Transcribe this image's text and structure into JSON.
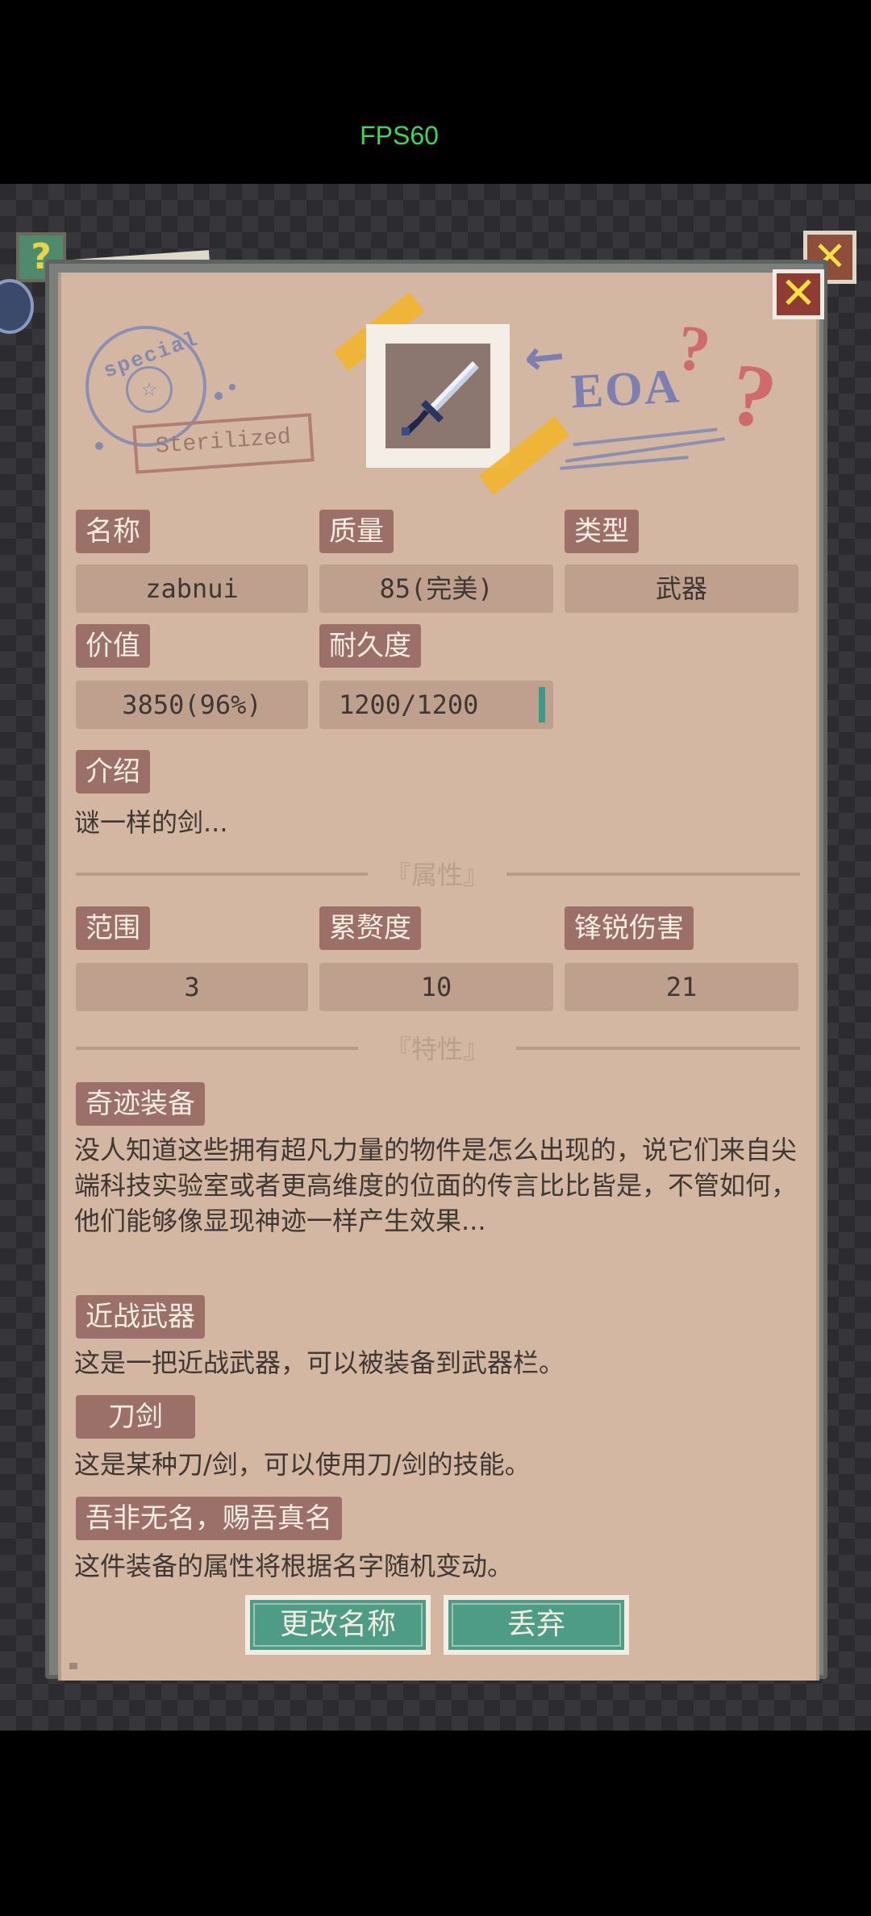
{
  "status": {
    "fps": "FPS60"
  },
  "panel": {
    "stamp": {
      "text": "special",
      "badge": "Sterilized"
    },
    "logo": "EOA",
    "fields": {
      "name_label": "名称",
      "name_value": "zabnui",
      "quality_label": "质量",
      "quality_value": "85(完美)",
      "type_label": "类型",
      "type_value": "武器",
      "value_label": "价值",
      "value_value": "3850(96%)",
      "durability_label": "耐久度",
      "durability_value": "1200/1200"
    },
    "durability_fraction": 1.0,
    "intro_label": "介绍",
    "intro_text": "谜一样的剑...",
    "attributes_title": "『属性』",
    "attributes": {
      "range_label": "范围",
      "range_value": "3",
      "fatigue_label": "累赘度",
      "fatigue_value": "10",
      "sharp_label": "锋锐伤害",
      "sharp_value": "21"
    },
    "traits_title": "『特性』",
    "traits": [
      {
        "label": "奇迹装备",
        "desc": "没人知道这些拥有超凡力量的物件是怎么出现的，说它们来自尖端科技实验室或者更高维度的位面的传言比比皆是，不管如何，他们能够像显现神迹一样产生效果..."
      },
      {
        "label": "近战武器",
        "desc": "这是一把近战武器，可以被装备到武器栏。"
      },
      {
        "label": "刀剑",
        "desc": "这是某种刀/剑，可以使用刀/剑的技能。"
      },
      {
        "label": "吾非无名，赐吾真名",
        "desc": "这件装备的属性将根据名字随机变动。"
      }
    ],
    "buttons": {
      "rename": "更改名称",
      "discard": "丢弃"
    }
  }
}
